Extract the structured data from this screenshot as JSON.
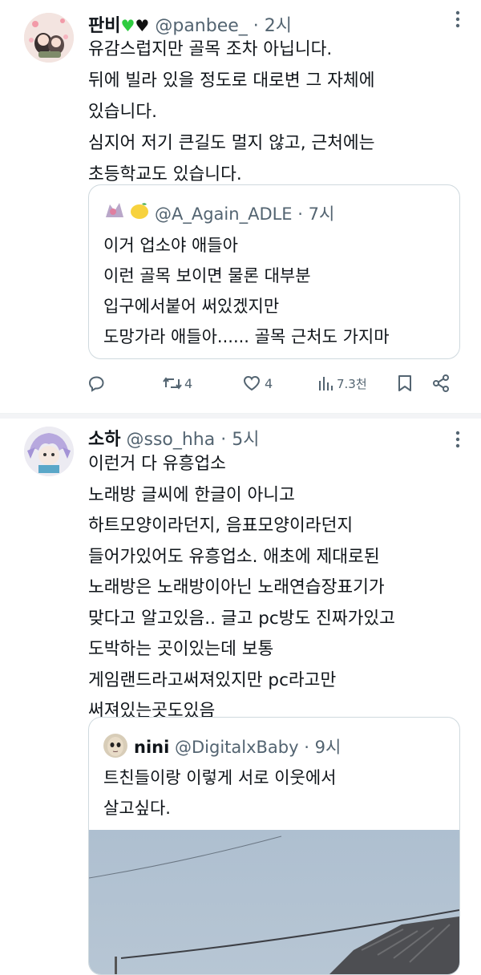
{
  "tweet1": {
    "name": "판비",
    "handle": "@panbee_",
    "time": "· 2시",
    "body": [
      "유감스럽지만 골목 조차 아닙니다.",
      "뒤에 빌라 있을 정도로 대로변 그 자체에",
      "있습니다.",
      "심지어 저기 큰길도 멀지 않고, 근처에는",
      "초등학교도 있습니다."
    ],
    "quote": {
      "handle": "@A_Again_ADLE",
      "time": "· 7시",
      "body": [
        "이거 업소야 애들아",
        "이런 골목 보이면 물론 대부분",
        "입구에서붙어 써있겠지만",
        "도망가라 애들아...... 골목 근처도 가지마"
      ]
    },
    "actions": {
      "reply_count": "",
      "retweet_count": "4",
      "like_count": "4",
      "views": "7.3천"
    }
  },
  "tweet2": {
    "name": "소하",
    "handle": "@sso_hha",
    "time": "· 5시",
    "body": [
      "이런거 다 유흥업소",
      "노래방 글씨에 한글이 아니고",
      "하트모양이라던지, 음표모양이라던지",
      "들어가있어도 유흥업소. 애초에 제대로된",
      "노래방은 노래방이아닌 노래연습장표기가",
      "맞다고 알고있음.. 글고 pc방도 진짜가있고",
      "도박하는 곳이있는데 보통",
      "게임랜드라고써져있지만 pc라고만",
      "써져있는곳도있음"
    ],
    "quote": {
      "name": "nini",
      "handle": "@DigitalxBaby",
      "time": "· 9시",
      "body": [
        "트친들이랑 이렇게 서로 이웃에서",
        "살고싶다."
      ]
    }
  },
  "colors": {
    "text": "#0f1419",
    "secondary": "#536471",
    "border": "#cfd9de",
    "heart_green": "#2ecc40"
  }
}
